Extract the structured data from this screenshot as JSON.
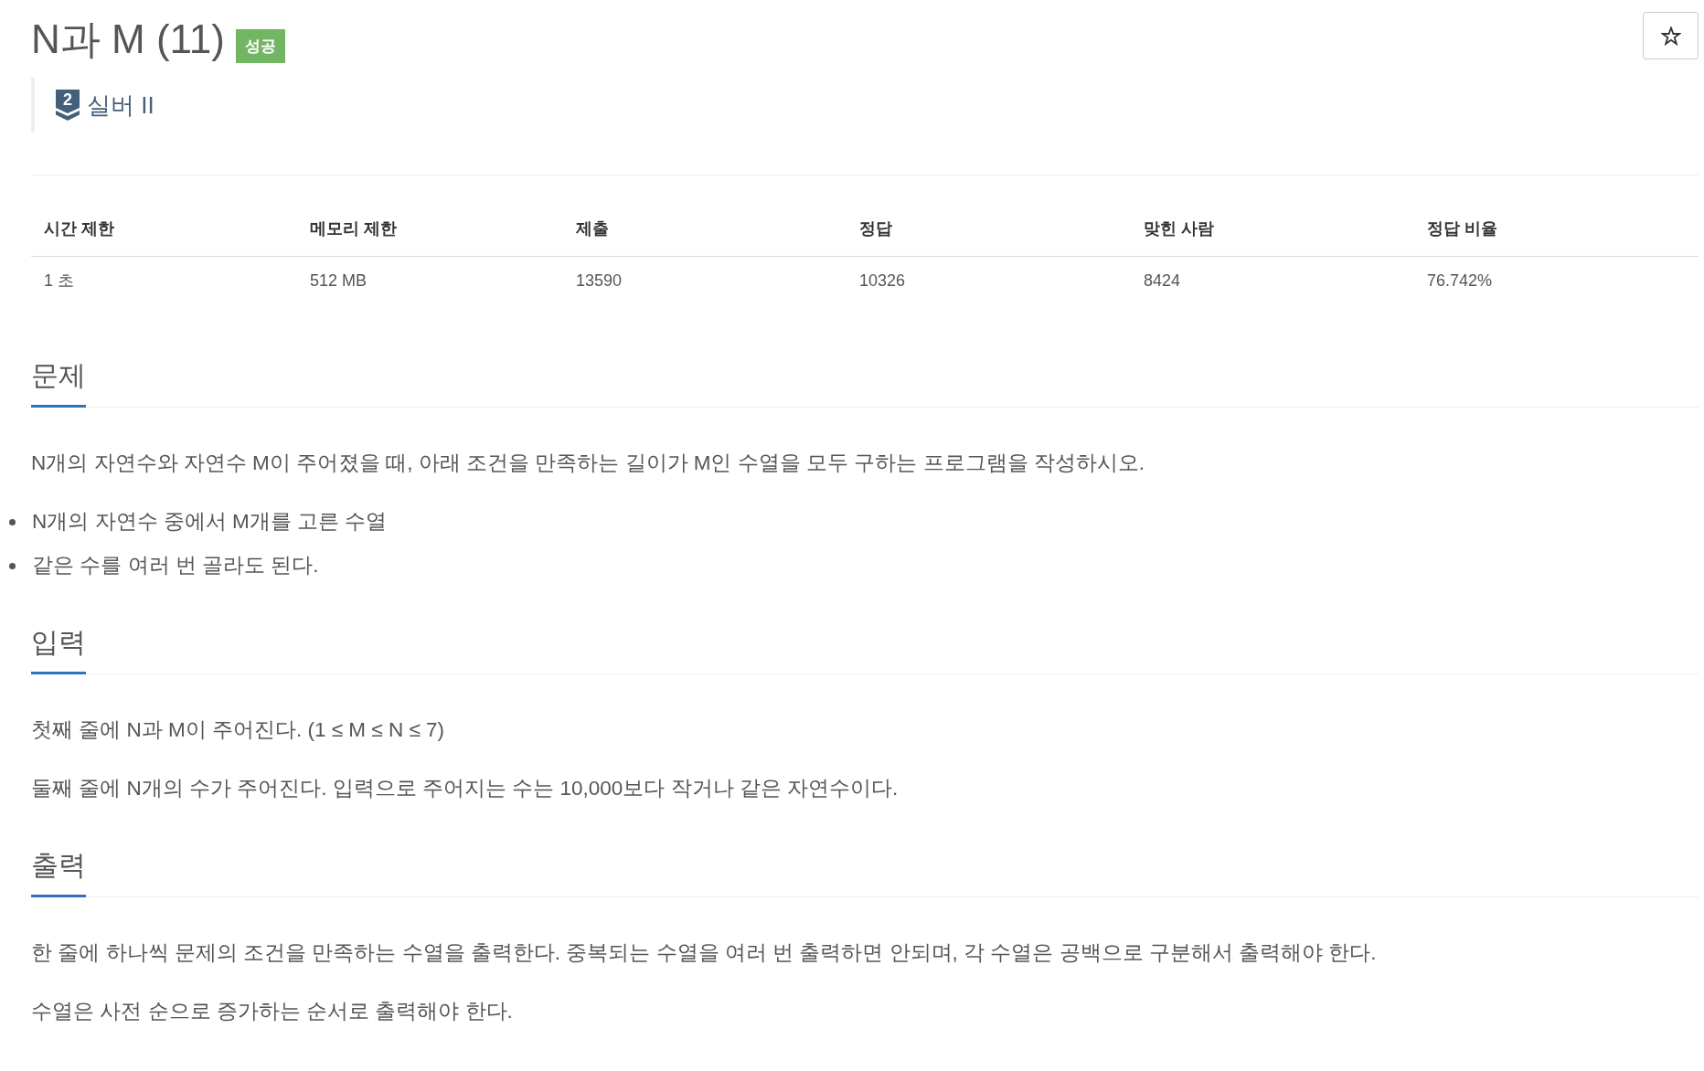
{
  "problem": {
    "title": "N과 M (11)",
    "badge": "성공",
    "tier": {
      "number": "2",
      "label": "실버 II"
    }
  },
  "info_table": {
    "columns": [
      "시간 제한",
      "메모리 제한",
      "제출",
      "정답",
      "맞힌 사람",
      "정답 비율"
    ],
    "rows": [
      [
        "1 초",
        "512 MB",
        "13590",
        "10326",
        "8424",
        "76.742%"
      ]
    ]
  },
  "sections": [
    {
      "title": "문제",
      "blocks": [
        {
          "kind": "paragraph",
          "text": "N개의 자연수와 자연수 M이 주어졌을 때, 아래 조건을 만족하는 길이가 M인 수열을 모두 구하는 프로그램을 작성하시오."
        },
        {
          "kind": "bullet",
          "text": "N개의 자연수 중에서 M개를 고른 수열"
        },
        {
          "kind": "bullet",
          "text": "같은 수를 여러 번 골라도 된다."
        }
      ]
    },
    {
      "title": "입력",
      "blocks": [
        {
          "kind": "paragraph",
          "text": "첫째 줄에 N과 M이 주어진다. (1 ≤ M ≤ N ≤ 7)"
        },
        {
          "kind": "paragraph",
          "text": "둘째 줄에 N개의 수가 주어진다. 입력으로 주어지는 수는 10,000보다 작거나 같은 자연수이다."
        }
      ]
    },
    {
      "title": "출력",
      "blocks": [
        {
          "kind": "paragraph",
          "text": "한 줄에 하나씩 문제의 조건을 만족하는 수열을 출력한다. 중복되는 수열을 여러 번 출력하면 안되며, 각 수열은 공백으로 구분해서 출력해야 한다."
        },
        {
          "kind": "paragraph",
          "text": "수열은 사전 순으로 증가하는 순서로 출력해야 한다."
        }
      ]
    }
  ]
}
